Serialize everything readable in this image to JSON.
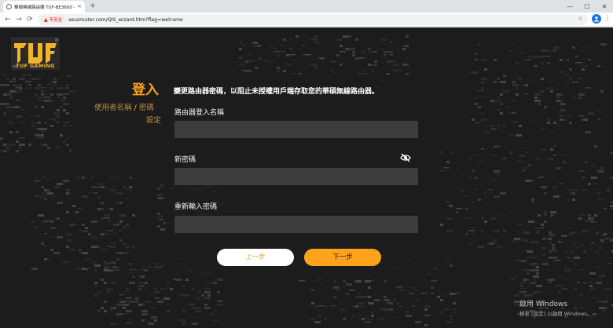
{
  "browser": {
    "tab_title": "華碩無線路由器 TUF-BE3600 -",
    "tab_close": "×",
    "new_tab": "+",
    "back": "←",
    "forward": "→",
    "reload": "⟳",
    "security_label": "不安全",
    "url": "asusrouter.com/QIS_wizard.htm?flag=welcome",
    "bookmark_star": "☆",
    "profile_initial": "👤",
    "menu": "⋮",
    "window_minimize": "—",
    "window_maximize": "☐",
    "window_close": "✕"
  },
  "logo": {
    "text": "TUF GAMING"
  },
  "steps": {
    "title": "登入",
    "step_username": "使用者名稱",
    "separator": "/",
    "step_password": "密碼",
    "step_setup": "設定"
  },
  "form": {
    "heading": "變更路由器密碼，以阻止未授權用戶端存取您的華碩無線路由器。",
    "login_name_label": "路由器登入名稱",
    "login_name_value": "",
    "new_password_label": "新密碼",
    "new_password_value": "",
    "confirm_password_label": "重新輸入密碼",
    "confirm_password_value": ""
  },
  "buttons": {
    "prev": "上一步",
    "next": "下一步"
  },
  "windows_watermark": {
    "title": "啟用 Windows",
    "subtitle": "移至 [設定] 以啟用 Windows。"
  },
  "colors": {
    "accent": "#ffa31a",
    "background": "#1c1c1c",
    "field": "#3c3c3c",
    "step_text": "#b88d43"
  },
  "icons": {
    "password_toggle": "eye-off-icon",
    "security": "warning-icon"
  }
}
